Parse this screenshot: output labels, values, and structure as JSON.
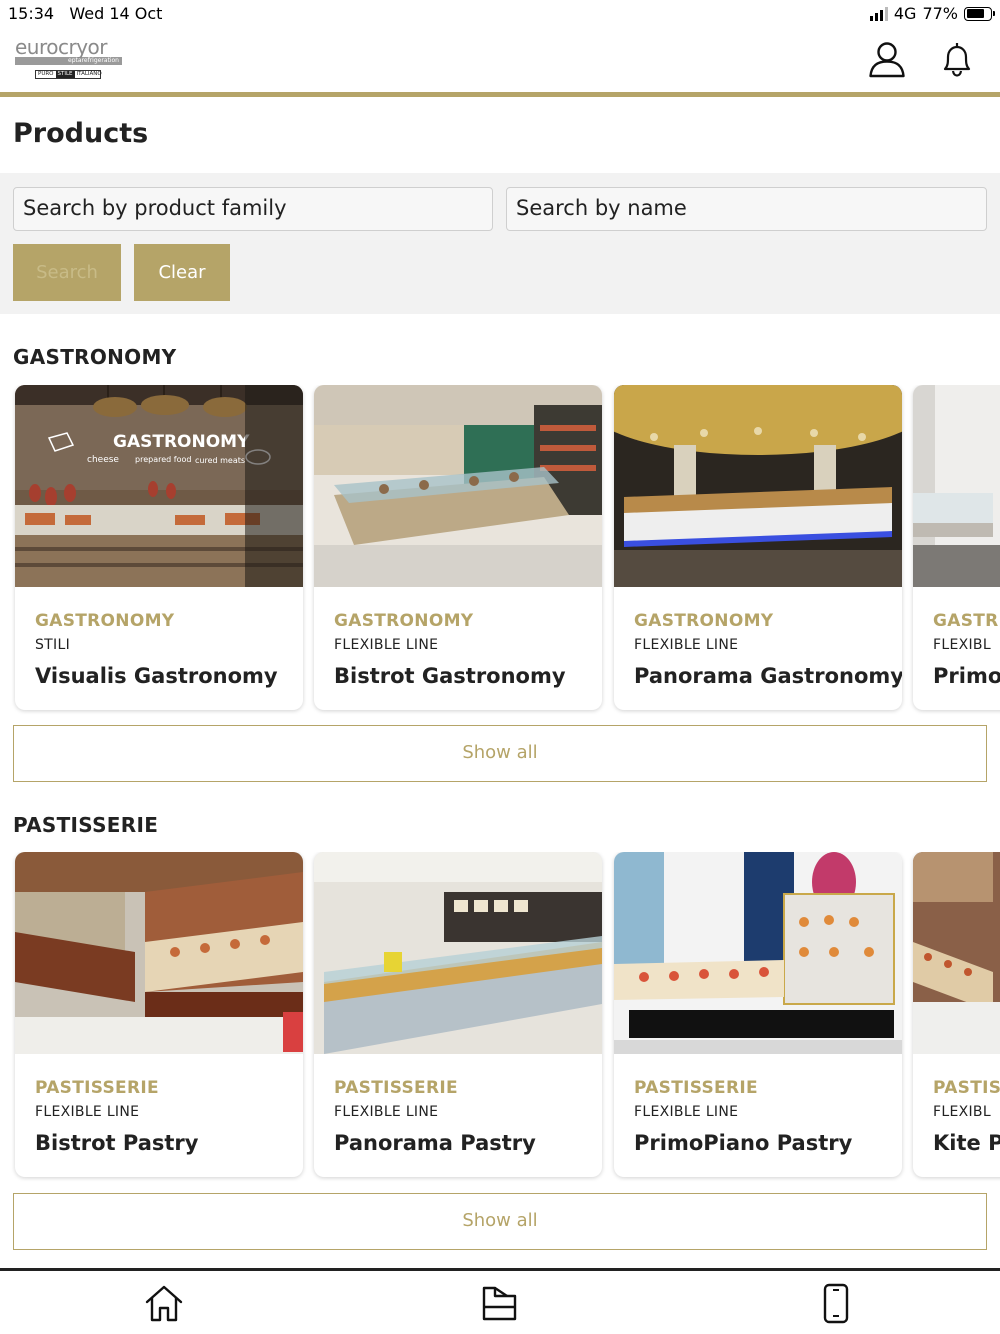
{
  "status_bar": {
    "time": "15:34",
    "date": "Wed 14 Oct",
    "network": "4G",
    "battery": "77%",
    "battery_level": 0.77
  },
  "header": {
    "logo": {
      "brand": "eurocryor",
      "sub": "eptarefrigeration",
      "tag": [
        "PURO",
        "STILE",
        "ITALIANO"
      ]
    },
    "icons": [
      "user-icon",
      "bell-icon"
    ]
  },
  "page": {
    "title": "Products"
  },
  "search": {
    "family_placeholder": "Search by product family",
    "name_placeholder": "Search by name",
    "search_label": "Search",
    "clear_label": "Clear"
  },
  "sections": [
    {
      "title": "GASTRONOMY",
      "show_all": "Show all",
      "cards": [
        {
          "family": "GASTRONOMY",
          "line": "STILI",
          "name": "Visualis Gastronomy",
          "image_signage": [
            "GASTRONOMY",
            "cheese",
            "prepared food",
            "cured meats"
          ]
        },
        {
          "family": "GASTRONOMY",
          "line": "FLEXIBLE LINE",
          "name": "Bistrot Gastronomy"
        },
        {
          "family": "GASTRONOMY",
          "line": "FLEXIBLE LINE",
          "name": "Panorama Gastronomy"
        },
        {
          "family": "GASTR",
          "line": "FLEXIBL",
          "name": "Primo"
        }
      ]
    },
    {
      "title": "PASTISSERIE",
      "show_all": "Show all",
      "cards": [
        {
          "family": "PASTISSERIE",
          "line": "FLEXIBLE LINE",
          "name": "Bistrot Pastry"
        },
        {
          "family": "PASTISSERIE",
          "line": "FLEXIBLE LINE",
          "name": "Panorama Pastry"
        },
        {
          "family": "PASTISSERIE",
          "line": "FLEXIBLE LINE",
          "name": "PrimoPiano Pastry"
        },
        {
          "family": "PASTIS",
          "line": "FLEXIBL",
          "name": "Kite P"
        }
      ]
    }
  ],
  "tab_bar": {
    "items": [
      "home-icon",
      "catalog-icon",
      "device-icon"
    ]
  },
  "colors": {
    "accent": "#b5a468",
    "panel": "#f2f2f2",
    "text": "#222222"
  }
}
